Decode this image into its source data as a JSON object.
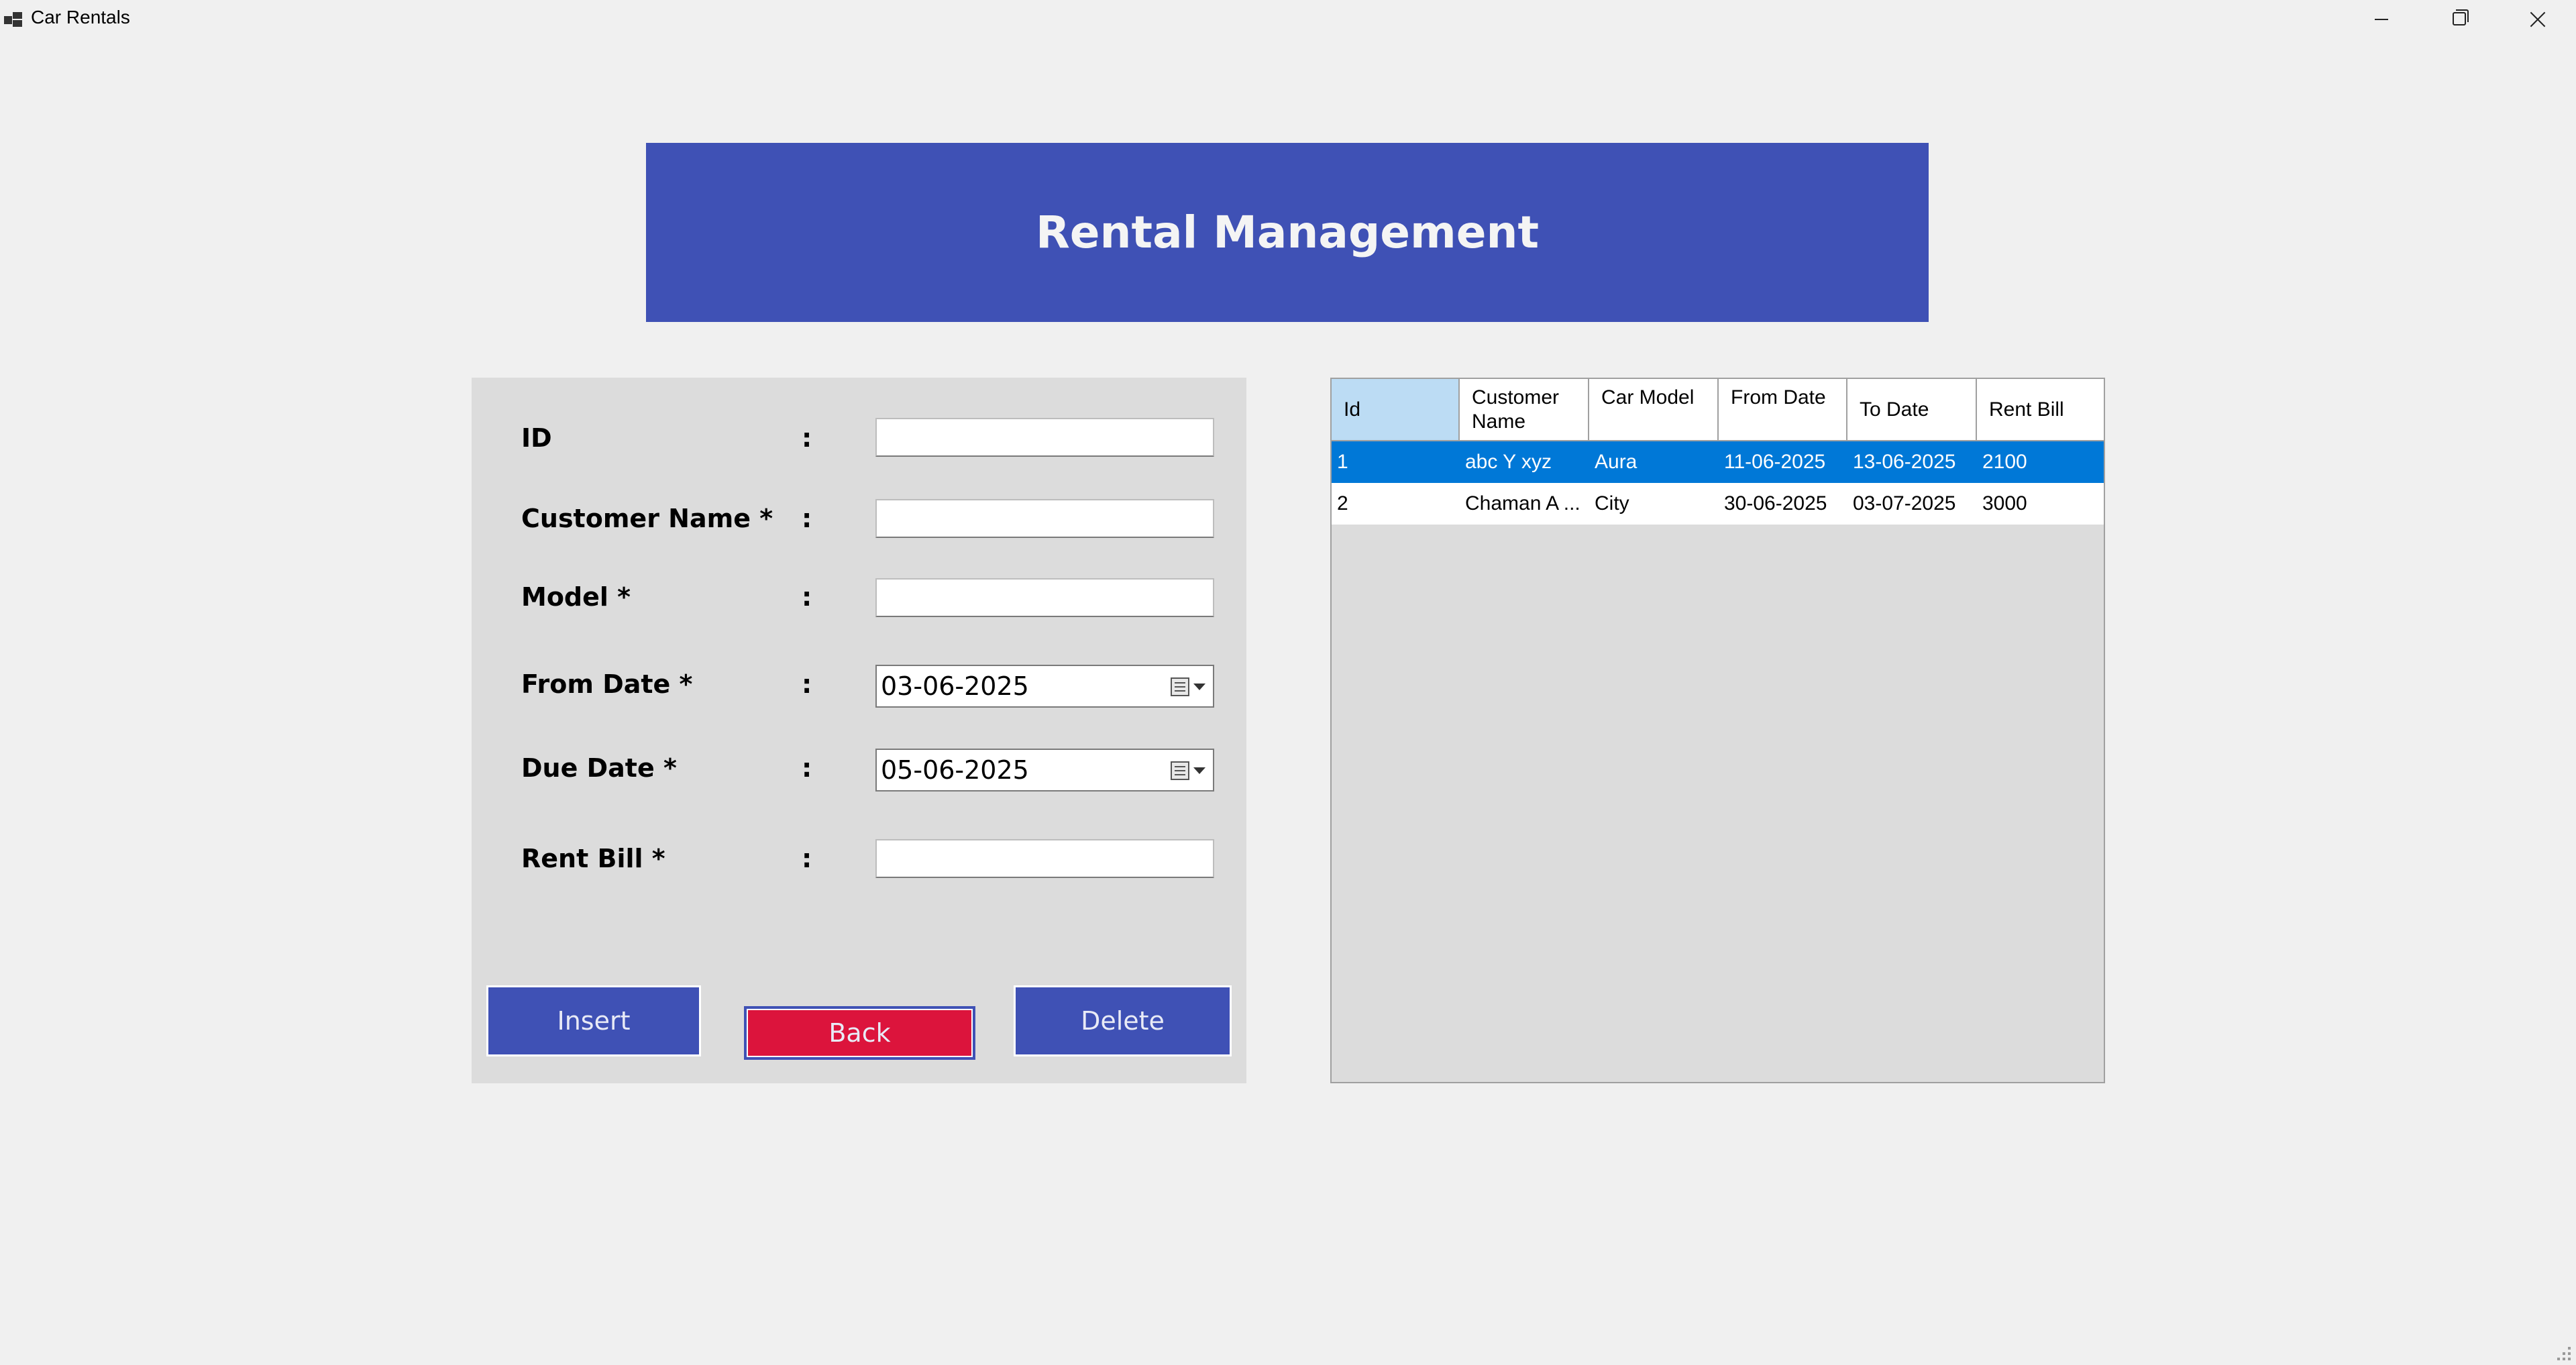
{
  "window": {
    "title": "Car Rentals",
    "icon": "app-icon"
  },
  "header": {
    "title": "Rental Management",
    "color": "#3f51b5"
  },
  "form": {
    "fields": [
      {
        "label": "ID",
        "value": ""
      },
      {
        "label": "Customer Name *",
        "value": ""
      },
      {
        "label": "Model *",
        "value": ""
      },
      {
        "label": "From Date *",
        "value": "03-06-2025"
      },
      {
        "label": "Due Date *",
        "value": "05-06-2025"
      },
      {
        "label": "Rent Bill *",
        "value": ""
      }
    ],
    "separator": ":",
    "buttons": {
      "insert": "Insert",
      "back": "Back",
      "delete": "Delete"
    }
  },
  "grid": {
    "columns": [
      {
        "label": "Id"
      },
      {
        "label": "Customer Name"
      },
      {
        "label": "Car Model"
      },
      {
        "label": "From Date"
      },
      {
        "label": "To Date"
      },
      {
        "label": "Rent Bill"
      }
    ],
    "rows": [
      {
        "cells": [
          "1",
          "abc Y xyz",
          "Aura",
          "11-06-2025",
          "13-06-2025",
          "2100"
        ],
        "selected": true
      },
      {
        "cells": [
          "2",
          "Chaman A ...",
          "City",
          "30-06-2025",
          "03-07-2025",
          "3000"
        ],
        "selected": false
      }
    ],
    "selected_color": "#0078d7"
  }
}
